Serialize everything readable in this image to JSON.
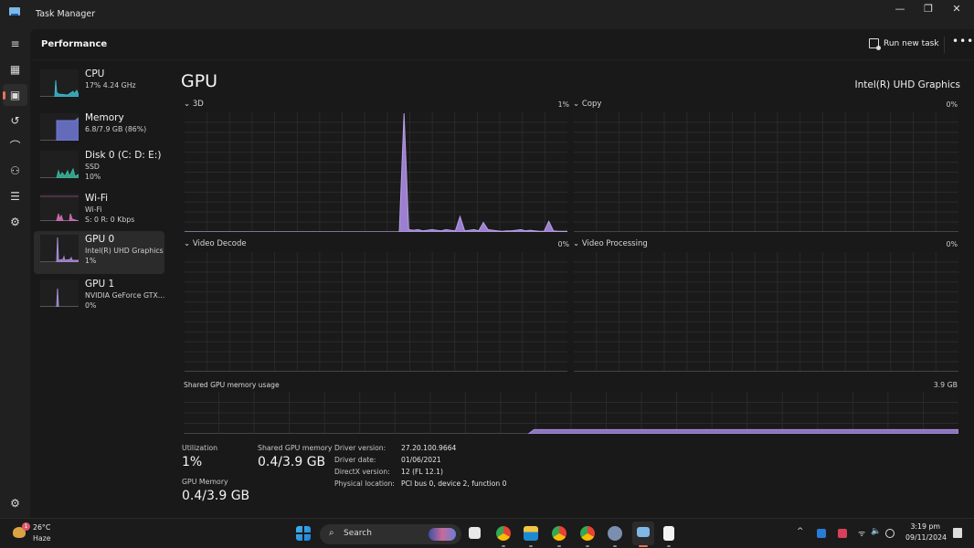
{
  "window": {
    "title": "Task Manager",
    "controls": {
      "minimize": "—",
      "restore": "❐",
      "close": "✕"
    }
  },
  "nav": {
    "items": [
      {
        "name": "hamburger-menu",
        "icon": "≡"
      },
      {
        "name": "processes",
        "icon": "▦"
      },
      {
        "name": "performance",
        "icon": "▣",
        "active": true
      },
      {
        "name": "app-history",
        "icon": "↺"
      },
      {
        "name": "startup-apps",
        "icon": "⌒"
      },
      {
        "name": "users",
        "icon": "⚇"
      },
      {
        "name": "details",
        "icon": "☰"
      },
      {
        "name": "services",
        "icon": "⚙"
      }
    ],
    "settings_icon": "⚙"
  },
  "header": {
    "title": "Performance",
    "run_new_task": "Run new task",
    "more": "•••"
  },
  "resources": [
    {
      "name": "CPU",
      "line2": "17% 4.24 GHz",
      "line3": "",
      "color": "#3bb6c9"
    },
    {
      "name": "Memory",
      "line2": "6.8/7.9 GB (86%)",
      "line3": "",
      "color": "#7179d6"
    },
    {
      "name": "Disk 0 (C: D: E:)",
      "line2": "SSD",
      "line3": "10%",
      "color": "#3ab59a"
    },
    {
      "name": "Wi-Fi",
      "line2": "Wi-Fi",
      "line3": "S: 0 R: 0 Kbps",
      "color": "#d46fb7"
    },
    {
      "name": "GPU 0",
      "line2": "Intel(R) UHD Graphics",
      "line3": "1%",
      "color": "#a98ad6",
      "active": true
    },
    {
      "name": "GPU 1",
      "line2": "NVIDIA GeForce GTX...",
      "line3": "0%",
      "color": "#a98ad6"
    }
  ],
  "gpu": {
    "title": "GPU",
    "model": "Intel(R) UHD Graphics",
    "engines": [
      {
        "label": "3D",
        "value": "1%"
      },
      {
        "label": "Copy",
        "value": "0%"
      },
      {
        "label": "Video Decode",
        "value": "0%"
      },
      {
        "label": "Video Processing",
        "value": "0%"
      }
    ],
    "shared_memory_graph": {
      "label": "Shared GPU memory usage",
      "max": "3.9 GB"
    },
    "stats": {
      "utilization_label": "Utilization",
      "utilization": "1%",
      "shared_label": "Shared GPU memory",
      "shared": "0.4/3.9 GB",
      "gpu_mem_label": "GPU Memory",
      "gpu_mem": "0.4/3.9 GB"
    },
    "details": [
      {
        "key": "Driver version:",
        "value": "27.20.100.9664"
      },
      {
        "key": "Driver date:",
        "value": "01/06/2021"
      },
      {
        "key": "DirectX version:",
        "value": "12 (FL 12.1)"
      },
      {
        "key": "Physical location:",
        "value": "PCI bus 0, device 2, function 0"
      }
    ],
    "series_3d_percent_of_scale": [
      0,
      0,
      0,
      0,
      0,
      0,
      0,
      0,
      0,
      0,
      0,
      0,
      0,
      0,
      0,
      0,
      0,
      0,
      0,
      0,
      0,
      0,
      0,
      0,
      0,
      0,
      0,
      0,
      0,
      0,
      0,
      0,
      0,
      0,
      0,
      0,
      0,
      0,
      0,
      0,
      0,
      0,
      0,
      0,
      0,
      0,
      0,
      100,
      2,
      1.5,
      2,
      1,
      1.5,
      2,
      1.5,
      1,
      2,
      1.5,
      1,
      13,
      1,
      1.5,
      2,
      1,
      8,
      2,
      1.5,
      1,
      0.5,
      1,
      1,
      1.5,
      2,
      1,
      1.5,
      1,
      0.5,
      0.5,
      9,
      1,
      0.5,
      0.5,
      0.5
    ],
    "shared_mem_fraction": 0.1
  },
  "taskbar": {
    "weather_temp": "26°C",
    "weather_cond": "Haze",
    "weather_badge": "1",
    "search_placeholder": "Search",
    "search_glyph": "⌕",
    "time": "3:19 pm",
    "date": "09/11/2024",
    "tray_chevron": "^",
    "tray_wifi": "ᯤ",
    "tray_volume": "🔈",
    "apps": [
      "task-view",
      "chrome",
      "file-explorer",
      "chrome-profile-2",
      "chrome-profile-3",
      "settings",
      "task-manager",
      "snipping-tool"
    ]
  }
}
